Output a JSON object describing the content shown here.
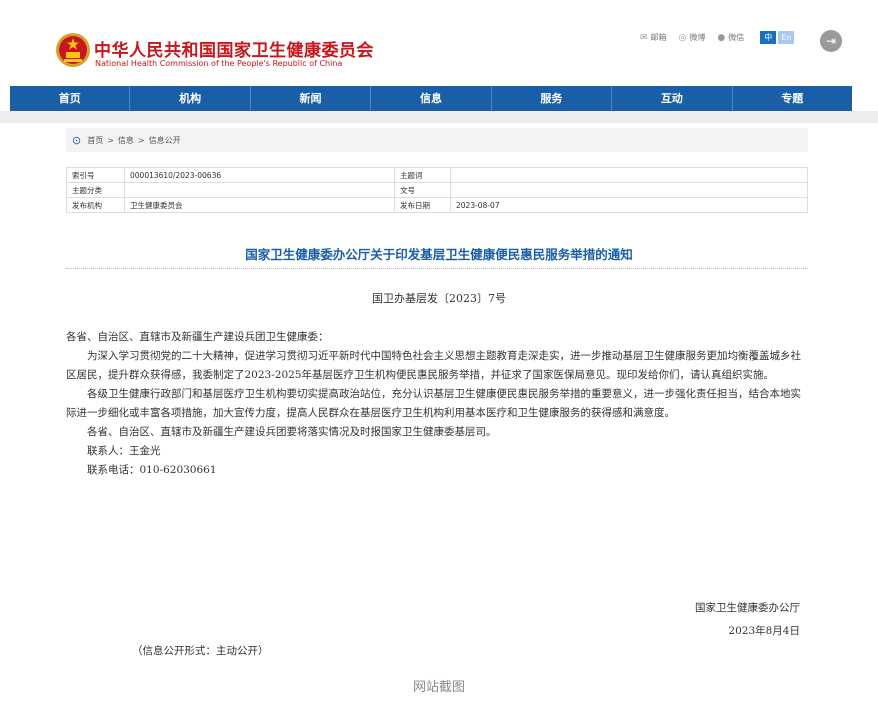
{
  "header": {
    "title": "中华人民共和国国家卫生健康委员会",
    "subtitle": "National Health Commission of the People's Republic of China",
    "links": [
      {
        "icon": "mail-icon",
        "glyph": "✉",
        "label": "邮箱"
      },
      {
        "icon": "weibo-icon",
        "glyph": "◎",
        "label": "微博"
      },
      {
        "icon": "wechat-icon",
        "glyph": "●",
        "label": "微信"
      }
    ],
    "lang_zh": "中",
    "lang_en": "En",
    "exit_glyph": "⇥"
  },
  "nav": {
    "items": [
      "首页",
      "机构",
      "新闻",
      "信息",
      "服务",
      "互动",
      "专题"
    ]
  },
  "breadcrumb": {
    "items": [
      "首页",
      "信息",
      "信息公开"
    ],
    "separator": ">"
  },
  "meta": {
    "index_label": "索引号",
    "index_value": "000013610/2023-00636",
    "keyword_label": "主题词",
    "keyword_value": "",
    "category_label": "主题分类",
    "category_value": "",
    "docnum_label": "文号",
    "docnum_value": "",
    "issuer_label": "发布机构",
    "issuer_value": "卫生健康委员会",
    "date_label": "发布日期",
    "date_value": "2023-08-07"
  },
  "document": {
    "title": "国家卫生健康委办公厅关于印发基层卫生健康便民惠民服务举措的通知",
    "number": "国卫办基层发〔2023〕7号",
    "salutation": "各省、自治区、直辖市及新疆生产建设兵团卫生健康委：",
    "para1": "为深入学习贯彻党的二十大精神，促进学习贯彻习近平新时代中国特色社会主义思想主题教育走深走实，进一步推动基层卫生健康服务更加均衡覆盖城乡社区居民，提升群众获得感，我委制定了2023-2025年基层医疗卫生机构便民惠民服务举措，并征求了国家医保局意见。现印发给你们，请认真组织实施。",
    "para2": "各级卫生健康行政部门和基层医疗卫生机构要切实提高政治站位，充分认识基层卫生健康便民惠民服务举措的重要意义，进一步强化责任担当，结合本地实际进一步细化或丰富各项措施，加大宣传力度，提高人民群众在基层医疗卫生机构利用基本医疗和卫生健康服务的获得感和满意度。",
    "para3": "各省、自治区、直辖市及新疆生产建设兵团要将落实情况及时报国家卫生健康委基层司。",
    "contact": "联系人：王金光",
    "phone": "联系电话：010-62030661",
    "sign_org": "国家卫生健康委办公厅",
    "sign_date": "2023年8月4日",
    "disclosure": "（信息公开形式：主动公开）"
  },
  "caption": "网站截图",
  "colors": {
    "brand_red": "#c8161d",
    "nav_blue": "#1a5ea8",
    "title_blue": "#1a5ea8"
  }
}
